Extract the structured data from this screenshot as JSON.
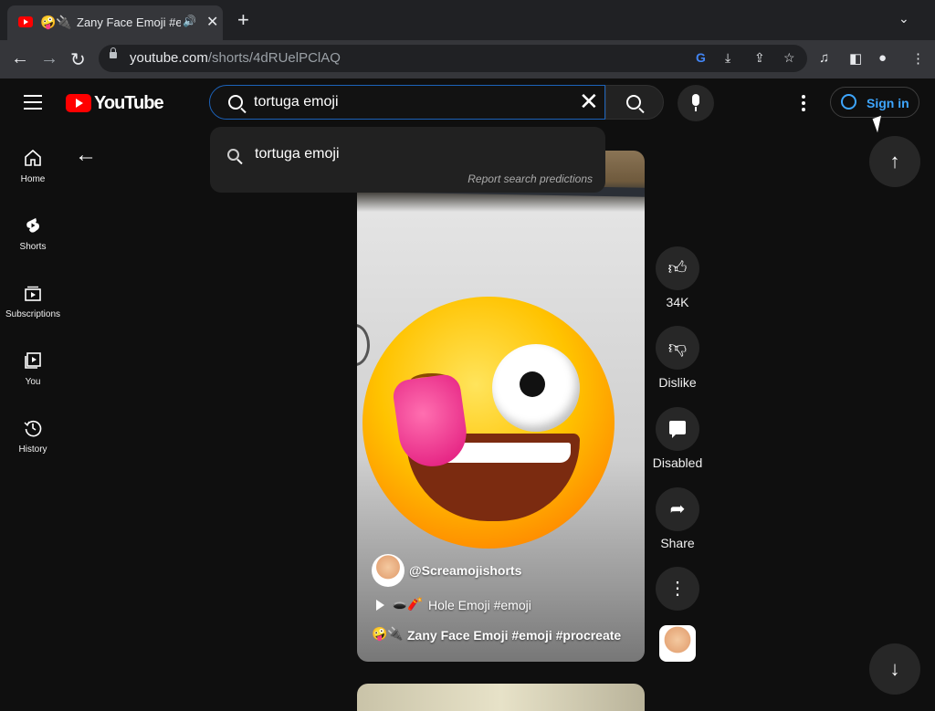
{
  "browser": {
    "tab": {
      "emoji": "🤪🔌",
      "title": "Zany Face Emoji #er",
      "audio_icon": "speaker-icon",
      "close": "✕"
    },
    "new_tab": "+",
    "tab_search": "⌄",
    "url_domain": "youtube.com",
    "url_path": "/shorts/4dRUelPClAQ"
  },
  "header": {
    "logo_text": "YouTube",
    "search": {
      "value": "tortuga emoji",
      "clear": "✕"
    },
    "signin_label": "Sign in"
  },
  "dropdown": {
    "suggestion": "tortuga emoji",
    "report": "Report search predictions"
  },
  "sidebar": {
    "items": [
      {
        "label": "Home",
        "icon": "home-icon"
      },
      {
        "label": "Shorts",
        "icon": "shorts-icon"
      },
      {
        "label": "Subscriptions",
        "icon": "subscriptions-icon"
      },
      {
        "label": "You",
        "icon": "you-icon"
      },
      {
        "label": "History",
        "icon": "history-icon"
      }
    ]
  },
  "video": {
    "channel": "@Screamojishorts",
    "episode_emoji": "🕳️🧨",
    "episode_title": "Hole Emoji #emoji",
    "desc_emoji": "🤪🔌",
    "description": "Zany Face Emoji #emoji #procreate"
  },
  "actions": {
    "like_count": "34K",
    "dislike_label": "Dislike",
    "comments_label": "Disabled",
    "share_label": "Share"
  },
  "colors": {
    "brand_red": "#ff0000",
    "link_blue": "#3ea6ff",
    "search_focus": "#1c62b9",
    "background": "#0f0f0f"
  }
}
